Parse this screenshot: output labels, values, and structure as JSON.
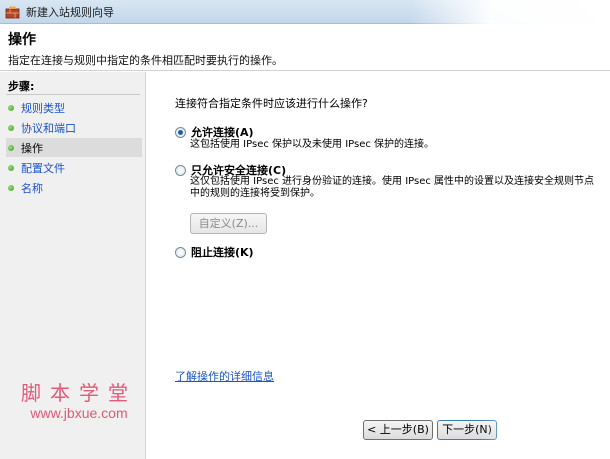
{
  "window": {
    "title": "新建入站规则向导"
  },
  "header": {
    "title": "操作",
    "description": "指定在连接与规则中指定的条件相匹配时要执行的操作。"
  },
  "sidebar": {
    "steps_label": "步骤:",
    "items": [
      {
        "label": "规则类型",
        "current": false
      },
      {
        "label": "协议和端口",
        "current": false
      },
      {
        "label": "操作",
        "current": true
      },
      {
        "label": "配置文件",
        "current": false
      },
      {
        "label": "名称",
        "current": false
      }
    ]
  },
  "watermark": {
    "chinese": "脚本学堂",
    "url": "www.jbxue.com"
  },
  "main": {
    "question": "连接符合指定条件时应该进行什么操作?",
    "options": [
      {
        "label": "允许连接(A)",
        "description": "这包括使用 IPsec 保护以及未使用 IPsec 保护的连接。",
        "checked": true
      },
      {
        "label": "只允许安全连接(C)",
        "description": "这仅包括使用 IPsec 进行身份验证的连接。使用 IPsec 属性中的设置以及连接安全规则节点中的规则的连接将受到保护。",
        "checked": false
      },
      {
        "label": "阻止连接(K)",
        "description": "",
        "checked": false
      }
    ],
    "customize_button": "自定义(Z)...",
    "learn_more_link": "了解操作的详细信息"
  },
  "footer": {
    "back_button": "< 上一步(B)",
    "next_button": "下一步(N)"
  }
}
